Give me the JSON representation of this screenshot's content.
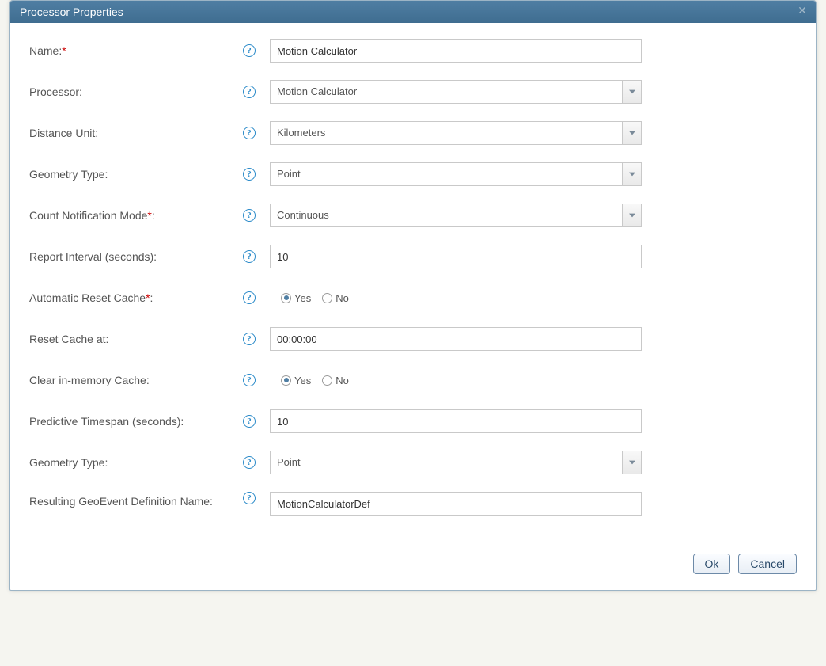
{
  "dialog": {
    "title": "Processor Properties",
    "fields": {
      "name": {
        "label": "Name:",
        "required": true,
        "value": "Motion Calculator"
      },
      "processor": {
        "label": "Processor:",
        "value": "Motion Calculator"
      },
      "distanceUnit": {
        "label": "Distance Unit:",
        "value": "Kilometers"
      },
      "geometryType1": {
        "label": "Geometry Type:",
        "value": "Point"
      },
      "countNotificationMode": {
        "label": "Count Notification Mode",
        "required": true,
        "suffix": ":",
        "value": "Continuous"
      },
      "reportInterval": {
        "label": "Report Interval (seconds):",
        "value": "10"
      },
      "autoResetCache": {
        "label": "Automatic Reset Cache",
        "required": true,
        "suffix": ":",
        "yes": "Yes",
        "no": "No",
        "selected": "yes"
      },
      "resetCacheAt": {
        "label": "Reset Cache at:",
        "value": "00:00:00"
      },
      "clearInMemory": {
        "label": "Clear in-memory Cache:",
        "yes": "Yes",
        "no": "No",
        "selected": "yes"
      },
      "predictiveTimespan": {
        "label": "Predictive Timespan (seconds):",
        "value": "10"
      },
      "geometryType2": {
        "label": "Geometry Type:",
        "value": "Point"
      },
      "resultingDef": {
        "label": "Resulting GeoEvent Definition Name:",
        "value": "MotionCalculatorDef"
      }
    },
    "buttons": {
      "ok": "Ok",
      "cancel": "Cancel"
    }
  }
}
